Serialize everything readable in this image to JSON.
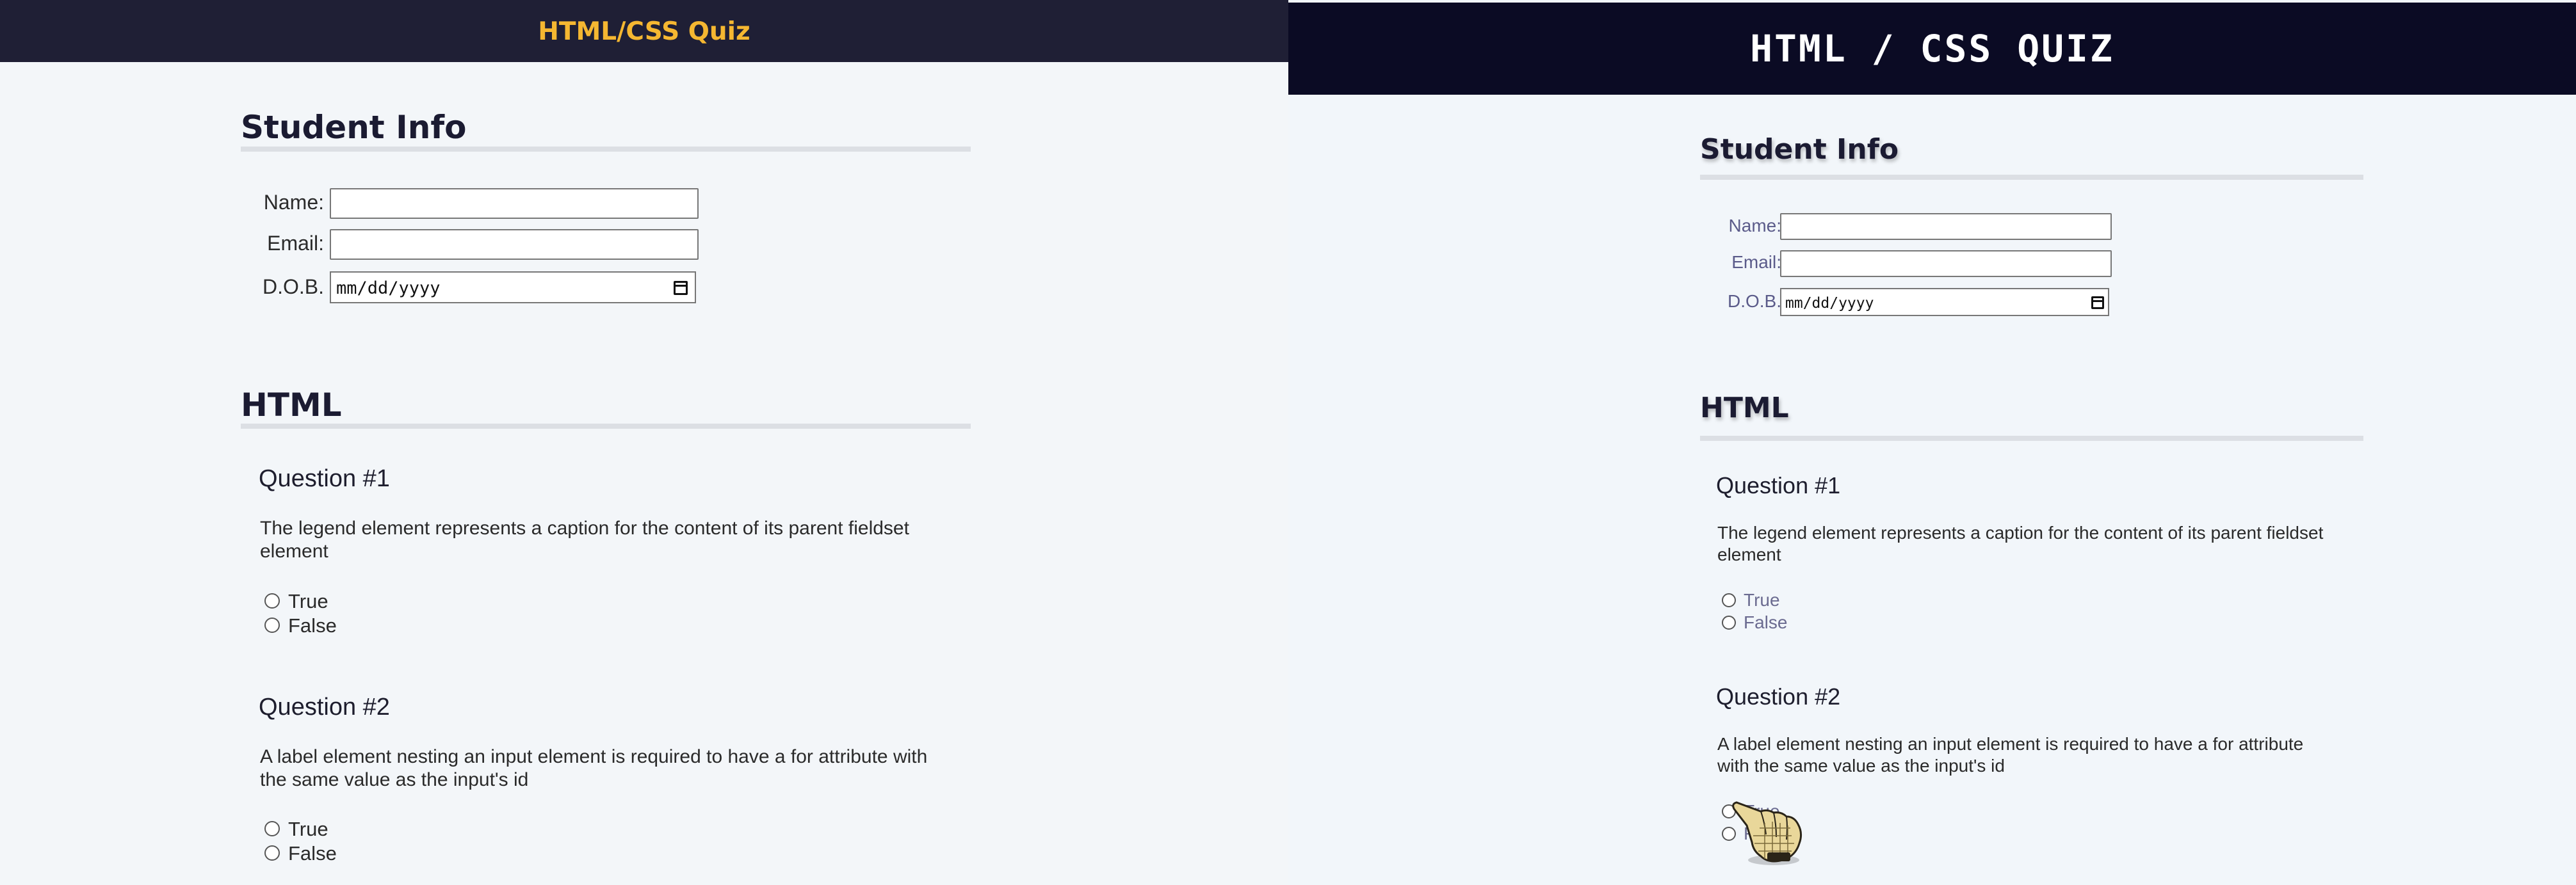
{
  "left": {
    "header_title": "HTML/CSS Quiz",
    "student_info": {
      "title": "Student Info",
      "name_label": "Name:",
      "email_label": "Email:",
      "dob_label": "D.O.B.",
      "dob_value": "mm/dd/yyyy"
    },
    "html_section": {
      "title": "HTML",
      "questions": [
        {
          "title": "Question #1",
          "text": "The legend element represents a caption for the content of its parent fieldset element",
          "options": [
            "True",
            "False"
          ]
        },
        {
          "title": "Question #2",
          "text": "A label element nesting an input element is required to have a for attribute with the same value as the input's id",
          "options": [
            "True",
            "False"
          ]
        }
      ]
    }
  },
  "right": {
    "header_title": "HTML / CSS QUIZ",
    "student_info": {
      "title": "Student Info",
      "name_label": "Name:",
      "email_label": "Email:",
      "dob_label": "D.O.B.",
      "dob_value": "mm/dd/yyyy"
    },
    "html_section": {
      "title": "HTML",
      "questions": [
        {
          "title": "Question #1",
          "text": "The legend element represents a caption for the content of its parent fieldset element",
          "options": [
            "True",
            "False"
          ]
        },
        {
          "title": "Question #2",
          "text": "A label element nesting an input element is required to have a for attribute with the same value as the input's id",
          "options": [
            "True",
            "False"
          ]
        }
      ]
    }
  },
  "icons": {
    "date_picker": "calendar-icon",
    "cursor": "pointing-hand-cursor-icon"
  },
  "colors": {
    "left_header_bg": "#1f1f35",
    "left_header_text": "#f5b731",
    "right_header_bg": "#0b0b24",
    "page_bg": "#f3f6f9"
  }
}
